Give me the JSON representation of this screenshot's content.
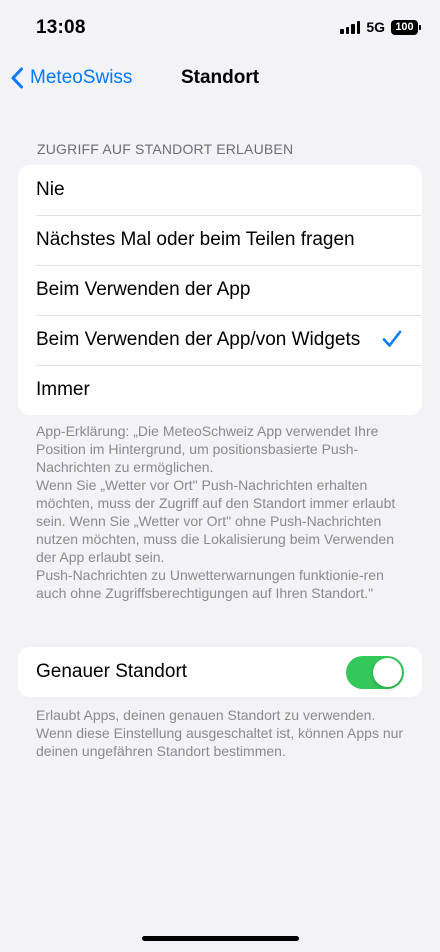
{
  "status": {
    "time": "13:08",
    "network": "5G",
    "battery": "100"
  },
  "nav": {
    "back_label": "MeteoSwiss",
    "title": "Standort"
  },
  "access": {
    "header": "ZUGRIFF AUF STANDORT ERLAUBEN",
    "options": [
      {
        "label": "Nie",
        "selected": false
      },
      {
        "label": "Nächstes Mal oder beim Teilen fragen",
        "selected": false
      },
      {
        "label": "Beim Verwenden der App",
        "selected": false
      },
      {
        "label": "Beim Verwenden der App/von Widgets",
        "selected": true
      },
      {
        "label": "Immer",
        "selected": false
      }
    ],
    "footer": "App-Erklärung: „Die MeteoSchweiz App verwendet Ihre Position im Hintergrund, um positionsbasierte Push-Nachrichten zu ermöglichen.\nWenn Sie „Wetter vor Ort\" Push-Nachrichten erhalten möchten, muss der Zugriff auf den Standort immer erlaubt sein. Wenn Sie „Wetter vor Ort\" ohne Push-Nachrichten nutzen möchten, muss die Lokalisierung beim Verwenden der App erlaubt sein.\nPush-Nachrichten zu Unwetterwarnungen funktionie-ren auch ohne Zugriffsberechtigungen auf Ihren Standort.\""
  },
  "precise": {
    "label": "Genauer Standort",
    "enabled": true,
    "footer": "Erlaubt Apps, deinen genauen Standort zu verwenden. Wenn diese Einstellung ausgeschaltet ist, können Apps nur deinen ungefähren Standort bestimmen."
  },
  "colors": {
    "accent": "#007aff",
    "toggle_on": "#34c759",
    "background": "#f2f2f7"
  }
}
